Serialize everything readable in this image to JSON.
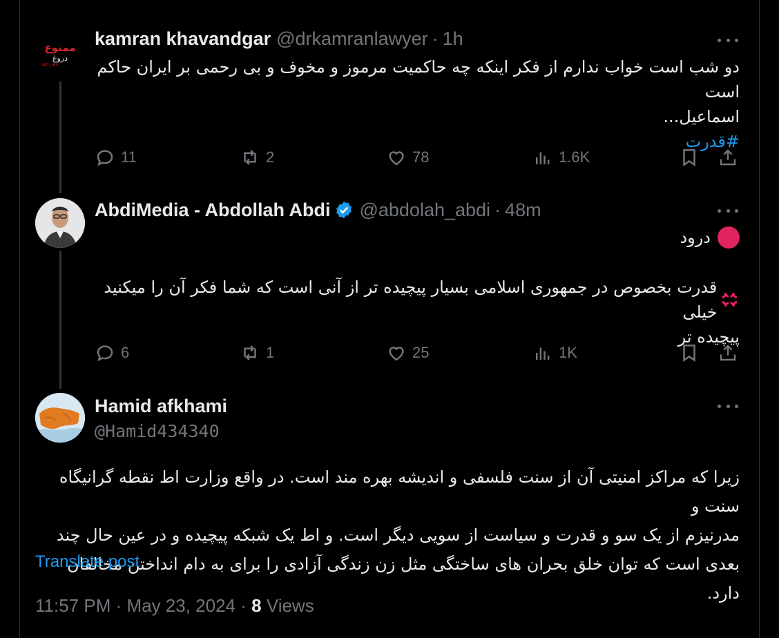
{
  "tweets": [
    {
      "name": "kamran khavandgar",
      "handle": "@drkamranlawyer",
      "time": "1h",
      "avatar_text": "ممنوع دروغ NO LIES",
      "lines": [
        "دو شب است خواب ندارم از فکر اینکه چه حاکمیت مرموز و مخوف و بی رحمی بر ایران حاکم است",
        "اسماعیل..."
      ],
      "hashtag": "#قدرت",
      "replies": "11",
      "reposts": "2",
      "likes": "78",
      "views": "1.6K"
    },
    {
      "name": "AbdiMedia - Abdollah Abdi",
      "handle": "@abdolah_abdi",
      "time": "48m",
      "verified": true,
      "line1": "درود",
      "line2": "قدرت بخصوص در جمهوری اسلامی بسیار پیچیده تر از آنی است که شما فکر آن را میکنید خیلی",
      "line3": "پیچیده تر",
      "replies": "6",
      "reposts": "1",
      "likes": "25",
      "views": "1K"
    },
    {
      "name": "Hamid afkhami",
      "handle": "@Hamid434340",
      "lines": [
        "زیرا که مراکز امنیتی آن از سنت فلسفی و اندیشه بهره مند است. در واقع وزارت اط نقطه گرانیگاه سنت و",
        "مدرنیزم از یک سو و قدرت و سیاست از سویی دیگر است. و اط یک شبکه پیچیده و در عین حال چند",
        "بعدی است که توان خلق بحران های ساختگی مثل زن زندگی آزادی را برای به دام انداختن مخالفان دارد."
      ],
      "translate": "Translate post",
      "timestamp": "11:57 PM · May 23, 2024 · ",
      "views_count": "8",
      "views_label": " Views"
    }
  ],
  "colors": {
    "bg": "#000000",
    "text": "#e7e9ea",
    "muted": "#71767b",
    "accent": "#1d9bf0",
    "red": "#e0245e"
  },
  "icons": [
    "reply-icon",
    "repost-icon",
    "like-icon",
    "views-icon",
    "bookmark-icon",
    "share-icon",
    "more-icon",
    "verified-icon"
  ]
}
